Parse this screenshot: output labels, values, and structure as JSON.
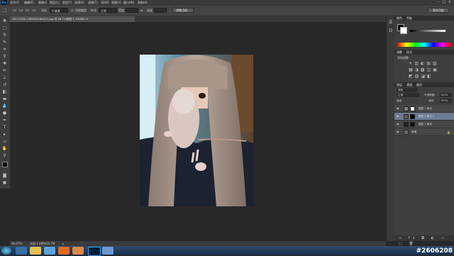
{
  "app": {
    "logo": "Ps"
  },
  "menu": [
    "文件(F)",
    "编辑(E)",
    "图像(I)",
    "图层(L)",
    "类型(Y)",
    "选择(S)",
    "滤镜(T)",
    "3D(D)",
    "视图(V)",
    "窗口(W)",
    "帮助(H)"
  ],
  "options_bar": {
    "tool_size": "1 像素",
    "feather_label": "羽化",
    "feather_value": "0 像素",
    "antialias_label": "消除锯齿",
    "style_label": "样式",
    "style_value": "正常",
    "width_label": "宽度",
    "height_label": "高度",
    "refine_edge_button": "调整边缘...",
    "workspace_button": "基本功能"
  },
  "document": {
    "tab_title": "1611121N_1389533180(d.1).jpg @ 46.7%(图层 1, RGB/8) ×"
  },
  "status": {
    "zoom": "46.67%",
    "doc_size": "文档:1.48M/35.7M"
  },
  "panels": {
    "color_tabs": [
      "颜色",
      "色板"
    ],
    "adjust_tabs": [
      "调整",
      "样式"
    ],
    "adjust_title": "添加调整",
    "layers_tabs": [
      "图层",
      "通道",
      "路径"
    ],
    "kind_label": "类型",
    "blend_mode": "正常",
    "opacity_label": "不透明度:",
    "opacity_value": "100%",
    "lock_label": "锁定:",
    "fill_label": "填充:",
    "fill_value": "100%",
    "layers": [
      {
        "name": "图层 1 拷贝",
        "selected": false
      },
      {
        "name": "图层 1 拷贝 2",
        "selected": true
      },
      {
        "name": "图层 1 拷贝",
        "selected": false
      },
      {
        "name": "背景",
        "selected": false
      }
    ]
  },
  "taskbar": {
    "watermark": "#2606208"
  },
  "colors": {
    "accent": "#31a8ff",
    "panel_bg": "#3f3f3f",
    "canvas_bg": "#282828",
    "selected_layer": "#6c7b93"
  }
}
